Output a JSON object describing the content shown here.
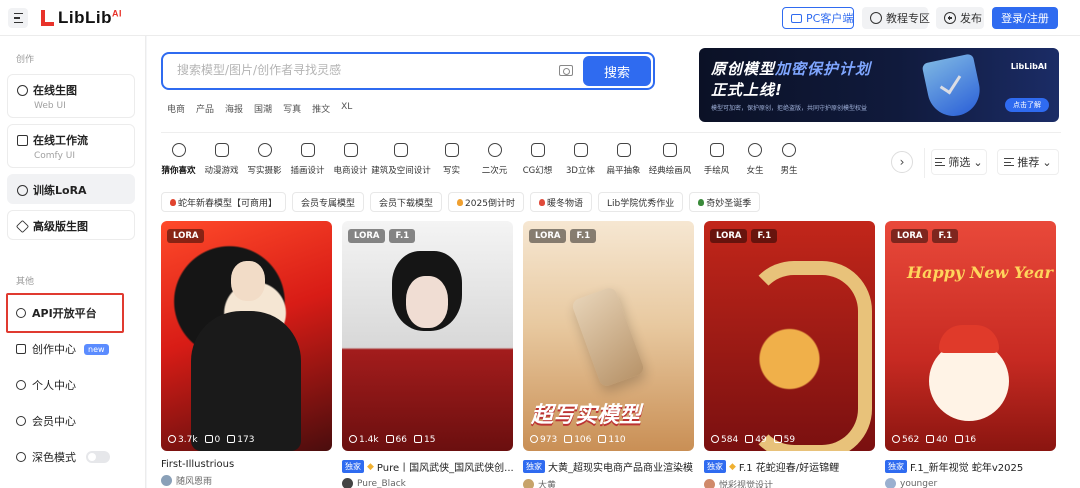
{
  "header": {
    "logo_text": "LibLib",
    "logo_sup": "AI",
    "pc_client": "PC客户端",
    "tutorials": "教程专区",
    "publish": "发布",
    "login": "登录/注册"
  },
  "sidebar": {
    "section_create": "创作",
    "cards": [
      {
        "title": "在线生图",
        "sub": "Web UI"
      },
      {
        "title": "在线工作流",
        "sub": "Comfy UI"
      },
      {
        "title": "训练LoRA",
        "sub": ""
      },
      {
        "title": "高级版生图",
        "sub": ""
      }
    ],
    "section_other": "其他",
    "links": {
      "api": "API开放平台",
      "creator": "创作中心",
      "creator_badge": "new",
      "personal": "个人中心",
      "member": "会员中心",
      "dark": "深色模式"
    }
  },
  "search": {
    "placeholder": "搜索模型/图片/创作者寻找灵感",
    "button": "搜索",
    "hot_tags": [
      "电商",
      "产品",
      "海报",
      "国潮",
      "写真",
      "推文",
      "XL"
    ]
  },
  "banner": {
    "line1_a": "原创模型",
    "line1_b": "加密保护计划",
    "line2": "正式上线!",
    "line3": "模型可加密，保护原创，拒绝盗版，共同守护原创模型权益",
    "logo": "LibLibAI",
    "button": "点击了解"
  },
  "categories": [
    {
      "label": "猜你喜欢",
      "active": true
    },
    {
      "label": "动漫游戏"
    },
    {
      "label": "写实摄影"
    },
    {
      "label": "插画设计"
    },
    {
      "label": "电商设计"
    },
    {
      "label": "建筑及空间设计"
    },
    {
      "label": "写实"
    },
    {
      "label": "二次元"
    },
    {
      "label": "CG幻想"
    },
    {
      "label": "3D立体"
    },
    {
      "label": "扁平抽象"
    },
    {
      "label": "经典绘画风"
    },
    {
      "label": "手绘风"
    },
    {
      "label": "女生"
    },
    {
      "label": "男生"
    }
  ],
  "filters": {
    "filter": "筛选",
    "sort": "推荐"
  },
  "chips": [
    {
      "label": "蛇年新春模型【可商用】",
      "dot": "#e0442f"
    },
    {
      "label": "会员专属模型"
    },
    {
      "label": "会员下载模型"
    },
    {
      "label": "2025倒计时",
      "dot": "#f0a030"
    },
    {
      "label": "暖冬物语",
      "dot": "#e04a3a"
    },
    {
      "label": "Lib学院优秀作业"
    },
    {
      "label": "奇妙圣诞季",
      "dot": "#3a8a3a"
    }
  ],
  "cards": [
    {
      "tags": [
        "LORA"
      ],
      "views": "3.7k",
      "downloads": "0",
      "images": "173",
      "exclusive": "",
      "title": "First-Illustrious",
      "author": "随风恩雨",
      "overlay": ""
    },
    {
      "tags": [
        "LORA",
        "F.1"
      ],
      "views": "1.4k",
      "downloads": "66",
      "images": "15",
      "exclusive": "独家",
      "title": "Pure丨国风武侠_国风武侠创...",
      "author": "Pure_Black",
      "overlay": ""
    },
    {
      "tags": [
        "LORA",
        "F.1"
      ],
      "views": "973",
      "downloads": "106",
      "images": "110",
      "exclusive": "独家",
      "title": "大黄_超现实电商产品商业渲染模...",
      "author": "大黄",
      "overlay": "超写实模型"
    },
    {
      "tags": [
        "LORA",
        "F.1"
      ],
      "views": "584",
      "downloads": "49",
      "images": "59",
      "exclusive": "独家",
      "title": "F.1 花蛇迎春/好运锦鲤",
      "author": "悦彩视觉设计",
      "overlay": ""
    },
    {
      "tags": [
        "LORA",
        "F.1"
      ],
      "views": "562",
      "downloads": "40",
      "images": "16",
      "exclusive": "独家",
      "title": "F.1_新年视觉 蛇年v2025",
      "author": "younger",
      "overlay": "Happy New Year"
    }
  ],
  "colors": {
    "accent": "#2f6bf0",
    "highlight": "#e03a30",
    "brand_red": "#e8322a"
  }
}
